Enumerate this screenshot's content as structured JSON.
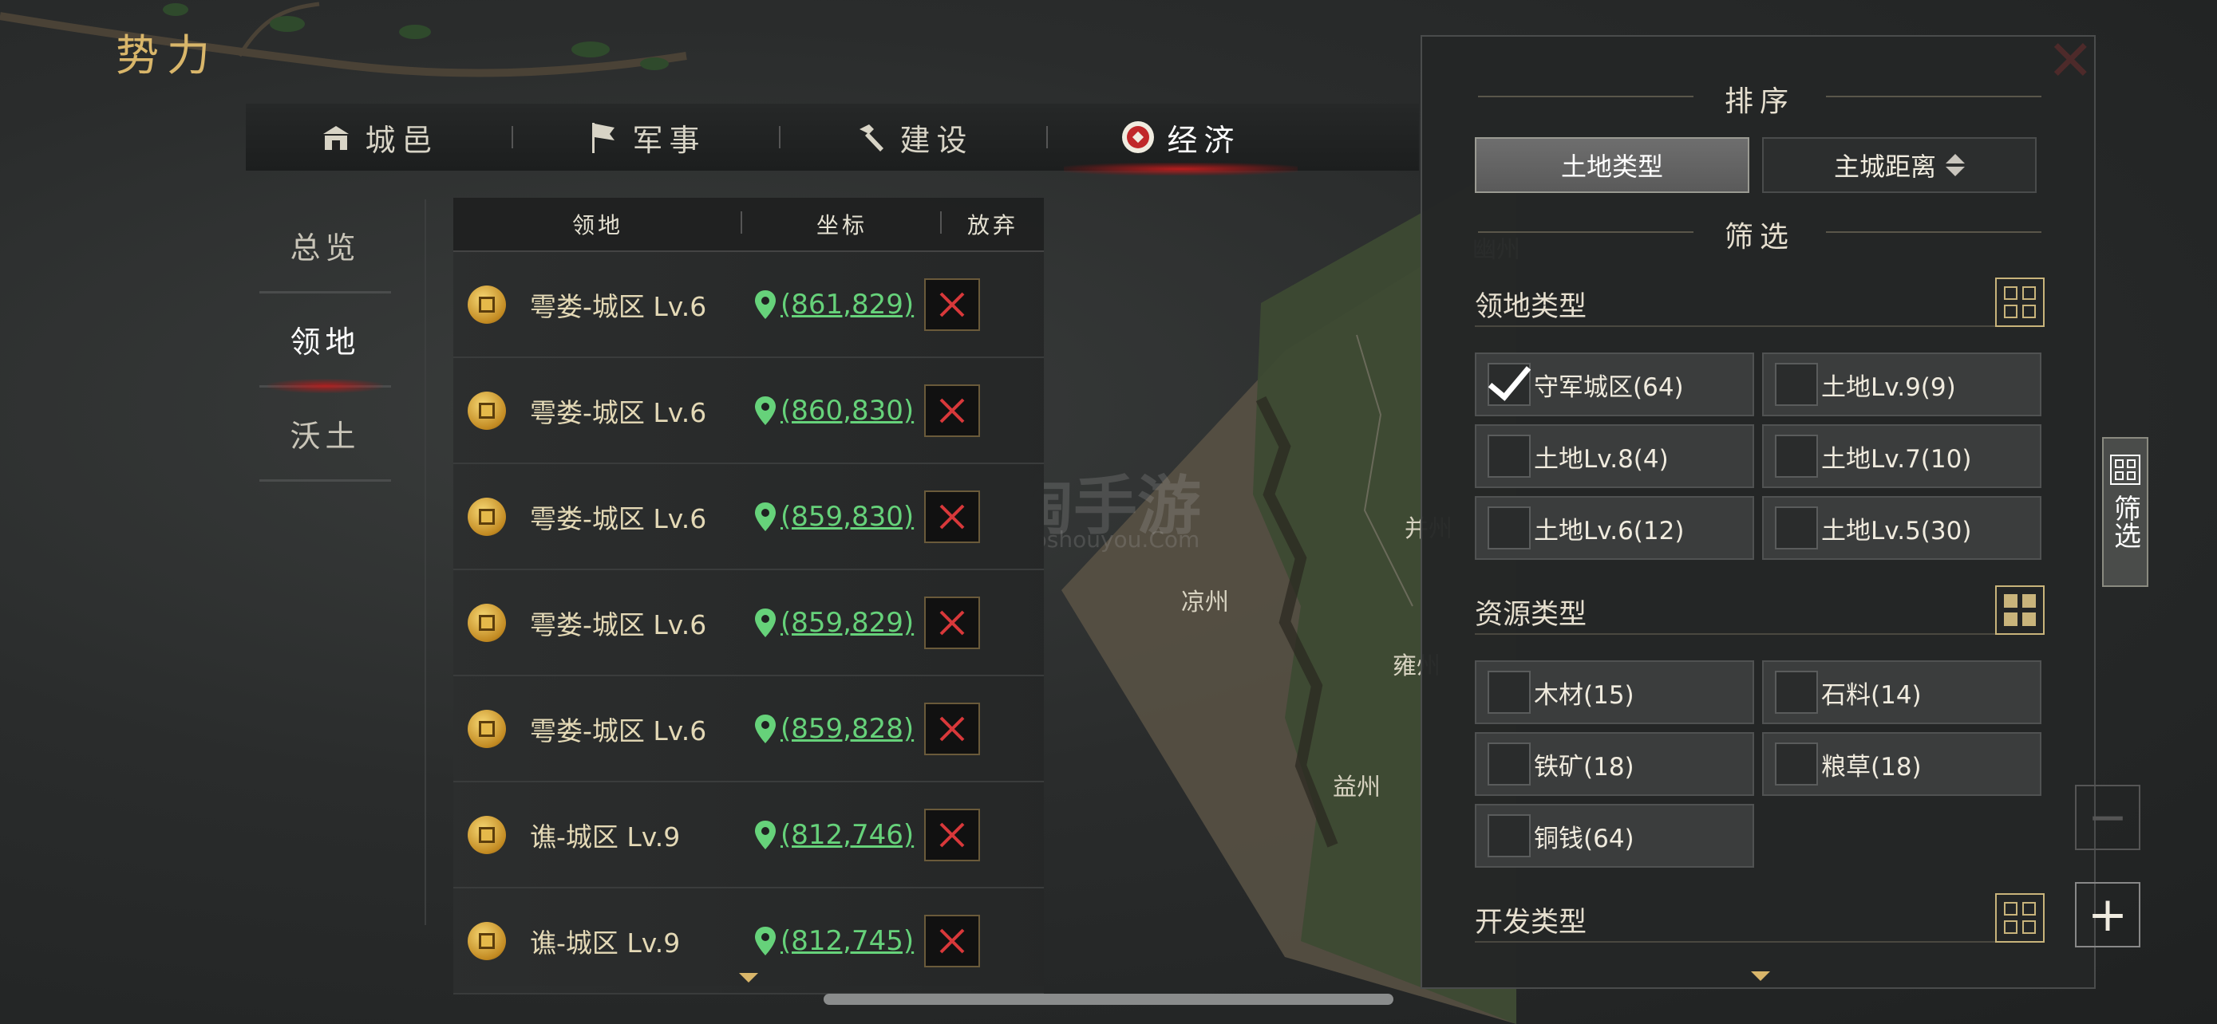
{
  "app_title": "势力",
  "tabs": [
    {
      "label": "城邑",
      "icon": "city-gate-icon"
    },
    {
      "label": "军事",
      "icon": "flag-icon"
    },
    {
      "label": "建设",
      "icon": "hammer-icon"
    },
    {
      "label": "经济",
      "icon": "coin-badge-icon",
      "active": true
    }
  ],
  "leftnav": [
    {
      "label": "总览"
    },
    {
      "label": "领地",
      "active": true
    },
    {
      "label": "沃土"
    }
  ],
  "table": {
    "headers": [
      "领地",
      "坐标",
      "放弃"
    ],
    "rows": [
      {
        "name": "雩娄-城区 Lv.6",
        "coord": "(861,829)"
      },
      {
        "name": "雩娄-城区 Lv.6",
        "coord": "(860,830)"
      },
      {
        "name": "雩娄-城区 Lv.6",
        "coord": "(859,830)"
      },
      {
        "name": "雩娄-城区 Lv.6",
        "coord": "(859,829)"
      },
      {
        "name": "雩娄-城区 Lv.6",
        "coord": "(859,828)"
      },
      {
        "name": "谯-城区 Lv.9",
        "coord": "(812,746)"
      },
      {
        "name": "谯-城区 Lv.9",
        "coord": "(812,745)"
      }
    ]
  },
  "map_labels": [
    "凉州",
    "雍州",
    "益州",
    "并州",
    "幽州"
  ],
  "watermark": {
    "main": "淘手游",
    "sub": "Taoshouyou.Com"
  },
  "panel": {
    "sort_title": "排序",
    "sort_options": [
      {
        "label": "土地类型",
        "selected": true
      },
      {
        "label": "主城距离",
        "selected": false
      }
    ],
    "filter_title": "筛选",
    "territory_type": {
      "label": "领地类型",
      "options": [
        {
          "label": "守军城区(64)",
          "checked": true
        },
        {
          "label": "土地Lv.9(9)",
          "checked": false
        },
        {
          "label": "土地Lv.8(4)",
          "checked": false
        },
        {
          "label": "土地Lv.7(10)",
          "checked": false
        },
        {
          "label": "土地Lv.6(12)",
          "checked": false
        },
        {
          "label": "土地Lv.5(30)",
          "checked": false
        }
      ]
    },
    "resource_type": {
      "label": "资源类型",
      "options": [
        {
          "label": "木材(15)",
          "checked": false
        },
        {
          "label": "石料(14)",
          "checked": false
        },
        {
          "label": "铁矿(18)",
          "checked": false
        },
        {
          "label": "粮草(18)",
          "checked": false
        },
        {
          "label": "铜钱(64)",
          "checked": false
        }
      ]
    },
    "develop_type": {
      "label": "开发类型"
    }
  },
  "side_tab": {
    "label": "筛选"
  },
  "zoom": {
    "minus": "−",
    "plus": "+"
  },
  "colors": {
    "gold": "#d9b66a",
    "coord_green": "#66d27a",
    "active_red": "#c81e1e"
  }
}
